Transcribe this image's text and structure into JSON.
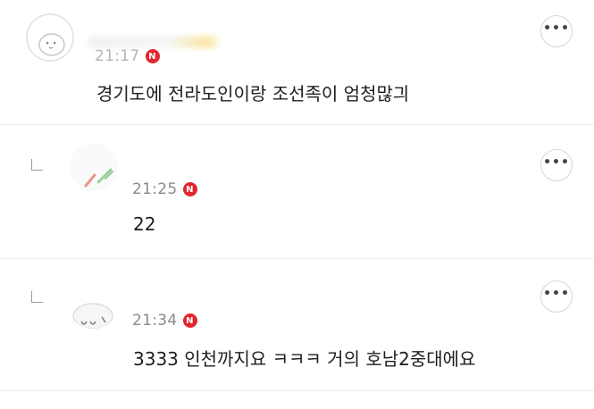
{
  "comments": [
    {
      "time": "21:17",
      "badge": "N",
      "text": "경기도에 전라도인이랑 조선족이 엄청많긔",
      "more": "•••",
      "is_reply": false
    },
    {
      "time": "21:25",
      "badge": "N",
      "text": "22",
      "more": "•••",
      "is_reply": true
    },
    {
      "time": "21:34",
      "badge": "N",
      "text": "3333 인천까지요 ㅋㅋㅋ 거의 호남2중대에요",
      "more": "•••",
      "is_reply": true
    }
  ],
  "colors": {
    "badge": "#e2262d",
    "time": "#8a8a8a",
    "divider": "#ececec"
  },
  "icons": {
    "more": "more-horizontal-icon",
    "new": "new-badge-icon",
    "reply": "reply-indent-icon",
    "avatar": "profile-avatar-icon"
  }
}
